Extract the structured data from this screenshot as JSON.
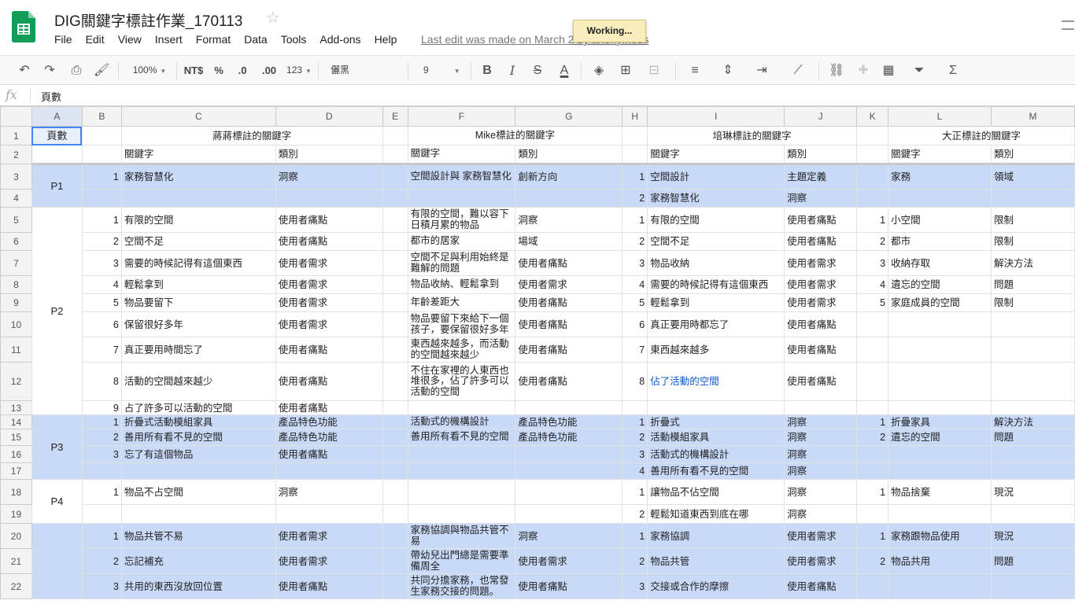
{
  "app": {
    "title": "DIG關鍵字標註作業_170113",
    "menus": [
      "File",
      "Edit",
      "View",
      "Insert",
      "Format",
      "Data",
      "Tools",
      "Add-ons",
      "Help"
    ],
    "last_edit": "Last edit was made on March 2 by anonymous",
    "status": "Working...",
    "colors": {
      "blue_row": "#c9daf8",
      "selection": "#4285f4",
      "link": "#1155cc",
      "toolbar_bg": "#f8f8f8"
    }
  },
  "toolbar": {
    "zoom": "100%",
    "currency": "NT$",
    "percent": "%",
    "dec_less": ".0",
    "dec_more": ".00",
    "more_formats": "123",
    "font": "儷黑 Pro",
    "font_size": "9",
    "bold": "B",
    "italic": "I",
    "strike": "S",
    "text_color": "A",
    "sum": "Σ"
  },
  "formula": {
    "fx": "fx",
    "value": "頁數"
  },
  "columns": [
    "A",
    "B",
    "C",
    "D",
    "E",
    "F",
    "G",
    "H",
    "I",
    "J",
    "K",
    "L",
    "M"
  ],
  "rows": [
    {
      "n": "1",
      "cells": [
        "頁數",
        "",
        "蔣蔣標註的關鍵字",
        "",
        "",
        "Mike標註的關鍵字",
        "",
        "",
        "培琳標註的關鍵字",
        "",
        "",
        "大正標註的關鍵字",
        ""
      ]
    },
    {
      "n": "2",
      "cells": [
        "",
        "",
        "關鍵字",
        "類別",
        "",
        "關鍵字",
        "類別",
        "",
        "關鍵字",
        "類別",
        "",
        "關鍵字",
        "類別"
      ]
    },
    {
      "n": "3",
      "cells": [
        "P1",
        "1",
        "家務智慧化",
        "洞察",
        "",
        "空間設計與 家務智慧化",
        "創新方向",
        "1",
        "空間設計",
        "主題定義",
        "",
        "家務",
        "領域"
      ]
    },
    {
      "n": "4",
      "cells": [
        "",
        "",
        "",
        "",
        "",
        "",
        "",
        "2",
        "家務智慧化",
        "洞察",
        "",
        "",
        ""
      ]
    },
    {
      "n": "5",
      "cells": [
        "P2",
        "1",
        "有限的空間",
        "使用者痛點",
        "",
        "有限的空間，難以容下日積月累的物品",
        "洞察",
        "1",
        "有限的空間",
        "使用者痛點",
        "1",
        "小空間",
        "限制"
      ]
    },
    {
      "n": "6",
      "cells": [
        "",
        "2",
        "空間不足",
        "使用者痛點",
        "",
        "都市的居家",
        "場域",
        "2",
        "空間不足",
        "使用者痛點",
        "2",
        "都市",
        "限制"
      ]
    },
    {
      "n": "7",
      "cells": [
        "",
        "3",
        "需要的時候記得有這個東西",
        "使用者需求",
        "",
        "空間不足與利用始終是難解的問題",
        "使用者痛點",
        "3",
        "物品收納",
        "使用者需求",
        "3",
        "收納存取",
        "解決方法"
      ]
    },
    {
      "n": "8",
      "cells": [
        "",
        "4",
        "輕鬆拿到",
        "使用者需求",
        "",
        "物品收納、輕鬆拿到",
        "使用者需求",
        "4",
        "需要的時候記得有這個東西",
        "使用者需求",
        "4",
        "遺忘的空間",
        "問題"
      ]
    },
    {
      "n": "9",
      "cells": [
        "",
        "5",
        "物品要留下",
        "使用者需求",
        "",
        "年齡差距大",
        "使用者痛點",
        "5",
        "輕鬆拿到",
        "使用者需求",
        "5",
        "家庭成員的空間",
        "限制"
      ]
    },
    {
      "n": "10",
      "cells": [
        "",
        "6",
        "保留很好多年",
        "使用者需求",
        "",
        "物品要留下來給下一個孩子，要保留很好多年",
        "使用者痛點",
        "6",
        "真正要用時都忘了",
        "使用者痛點",
        "",
        "",
        ""
      ]
    },
    {
      "n": "11",
      "cells": [
        "",
        "7",
        "真正要用時間忘了",
        "使用者痛點",
        "",
        "東西越來越多，而活動的空間越來越少",
        "使用者痛點",
        "7",
        "東西越來越多",
        "使用者痛點",
        "",
        "",
        ""
      ]
    },
    {
      "n": "12",
      "cells": [
        "",
        "8",
        "活動的空間越來越少",
        "使用者痛點",
        "",
        "不住在家裡的人東西也堆很多，佔了許多可以活動的空間",
        "使用者痛點",
        "8",
        "佔了活動的空間",
        "使用者痛點",
        "",
        "",
        ""
      ]
    },
    {
      "n": "13",
      "cells": [
        "",
        "9",
        "占了許多可以活動的空間",
        "使用者痛點",
        "",
        "",
        "",
        "",
        "",
        "",
        "",
        "",
        ""
      ]
    },
    {
      "n": "14",
      "cells": [
        "P3",
        "1",
        "折疊式活動模組家具",
        "產品特色功能",
        "",
        "活動式的機構設計",
        "產品特色功能",
        "1",
        "折疊式",
        "洞察",
        "1",
        "折疊家具",
        "解決方法"
      ]
    },
    {
      "n": "15",
      "cells": [
        "",
        "2",
        "善用所有看不見的空間",
        "產品特色功能",
        "",
        "善用所有看不見的空間",
        "產品特色功能",
        "2",
        "活動模組家具",
        "洞察",
        "2",
        "遺忘的空間",
        "問題"
      ]
    },
    {
      "n": "16",
      "cells": [
        "",
        "3",
        "忘了有這個物品",
        "使用者痛點",
        "",
        "",
        "",
        "3",
        "活動式的機構設計",
        "洞察",
        "",
        "",
        ""
      ]
    },
    {
      "n": "17",
      "cells": [
        "",
        "",
        "",
        "",
        "",
        "",
        "",
        "4",
        "善用所有看不見的空間",
        "洞察",
        "",
        "",
        ""
      ]
    },
    {
      "n": "18",
      "cells": [
        "P4",
        "1",
        "物品不占空間",
        "洞察",
        "",
        "",
        "",
        "1",
        "讓物品不佔空間",
        "洞察",
        "1",
        "物品捨棄",
        "現況"
      ]
    },
    {
      "n": "19",
      "cells": [
        "",
        "",
        "",
        "",
        "",
        "",
        "",
        "2",
        "輕鬆知道東西到底在哪",
        "洞察",
        "",
        "",
        ""
      ]
    },
    {
      "n": "20",
      "cells": [
        "",
        "1",
        "物品共管不易",
        "使用者需求",
        "",
        "家務協調與物品共管不易",
        "洞察",
        "1",
        "家務協調",
        "使用者需求",
        "1",
        "家務跟物品使用",
        "現況"
      ]
    },
    {
      "n": "21",
      "cells": [
        "",
        "2",
        "忘記補充",
        "使用者需求",
        "",
        "帶幼兒出門總是需要準備周全",
        "使用者需求",
        "2",
        "物品共管",
        "使用者需求",
        "2",
        "物品共用",
        "問題"
      ]
    },
    {
      "n": "22",
      "cells": [
        "",
        "3",
        "共用的東西沒放回位置",
        "使用者痛點",
        "",
        "共同分擔家務，也常發生家務交接的問題。",
        "使用者痛點",
        "3",
        "交接或合作的摩擦",
        "使用者痛點",
        "",
        "",
        ""
      ]
    }
  ]
}
